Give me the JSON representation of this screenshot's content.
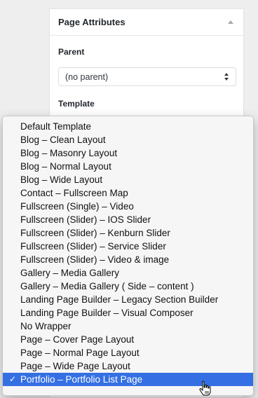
{
  "panel": {
    "title": "Page Attributes",
    "parent_label": "Parent",
    "parent_value": "(no parent)",
    "template_label": "Template"
  },
  "icons": {
    "collapse": "triangle-up-icon",
    "select_arrows": "up-down-chevron-icon",
    "checkmark": "check-icon",
    "cursor": "hand-pointer-icon"
  },
  "menu": {
    "items": [
      "Default Template",
      "Blog – Clean Layout",
      "Blog – Masonry Layout",
      "Blog – Normal Layout",
      "Blog – Wide Layout",
      "Contact – Fullscreen Map",
      "Fullscreen (Single) – Video",
      "Fullscreen (Slider) – IOS Slider",
      "Fullscreen (Slider) – Kenburn Slider",
      "Fullscreen (Slider) – Service Slider",
      "Fullscreen (Slider) – Video & image",
      "Gallery – Media Gallery",
      "Gallery – Media Gallery ( Side – content )",
      "Landing Page Builder – Legacy Section Builder",
      "Landing Page Builder – Visual Composer",
      "No Wrapper",
      "Page – Cover Page Layout",
      "Page – Normal Page Layout",
      "Page – Wide Page Layout",
      "Portfolio – Portfolio List Page"
    ],
    "selected_index": 19,
    "check_mark": "✓"
  },
  "colors": {
    "selection": "#3470e3",
    "panel_bg": "#ffffff",
    "page_bg": "#eeeeee"
  }
}
